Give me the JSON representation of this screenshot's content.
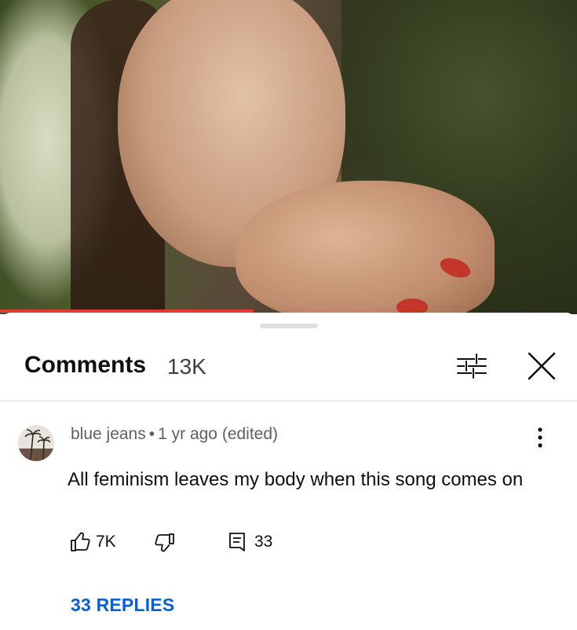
{
  "video": {
    "progress": 0.44
  },
  "comments_panel": {
    "title": "Comments",
    "count": "13K"
  },
  "comment": {
    "author": "blue jeans",
    "separator": "•",
    "time": "1 yr ago (edited)",
    "text": "All feminism leaves my body when this song comes on",
    "likes": "7K",
    "reply_count": "33",
    "replies_link": "33 REPLIES"
  },
  "icons": {
    "filter": "sliders-icon",
    "close": "close-icon",
    "more": "more-vertical-icon",
    "like": "thumbs-up-icon",
    "dislike": "thumbs-down-icon",
    "reply": "comment-icon"
  },
  "colors": {
    "accent": "#065fd4",
    "progress": "#e53935"
  }
}
